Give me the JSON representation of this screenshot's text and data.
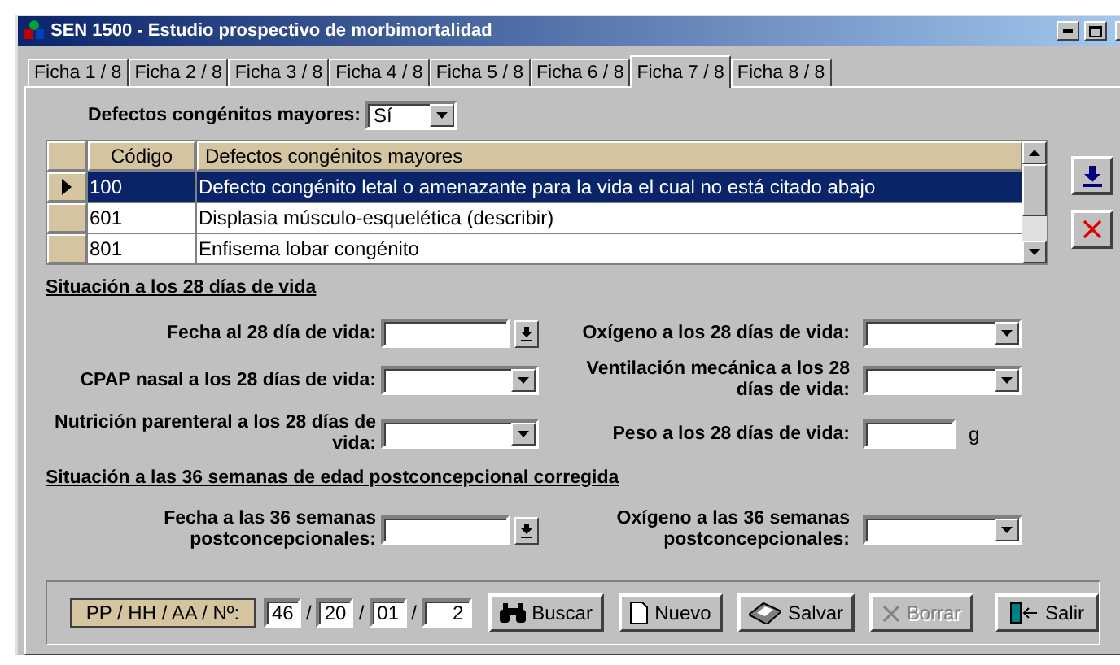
{
  "window": {
    "title": "SEN 1500 - Estudio prospectivo de morbimortalidad"
  },
  "tabs": [
    {
      "label": "Ficha 1 / 8",
      "selected": false
    },
    {
      "label": "Ficha 2 / 8",
      "selected": false
    },
    {
      "label": "Ficha 3 / 8",
      "selected": false
    },
    {
      "label": "Ficha 4 / 8",
      "selected": false
    },
    {
      "label": "Ficha 5 / 8",
      "selected": false
    },
    {
      "label": "Ficha 6 / 8",
      "selected": false
    },
    {
      "label": "Ficha 7 / 8",
      "selected": true
    },
    {
      "label": "Ficha 8 / 8",
      "selected": false
    }
  ],
  "defects_select": {
    "label": "Defectos congénitos mayores:",
    "value": "Sí"
  },
  "table": {
    "columns": [
      "Código",
      "Defectos congénitos mayores"
    ],
    "rows": [
      {
        "code": "100",
        "description": "Defecto congénito letal o amenazante para la vida el cual no está citado abajo",
        "selected": true
      },
      {
        "code": "601",
        "description": "Displasia músculo-esquelética (describir)",
        "selected": false
      },
      {
        "code": "801",
        "description": "Enfisema lobar congénito",
        "selected": false
      }
    ]
  },
  "sections": [
    {
      "heading": "Situación a los 28 días de vida",
      "fields": [
        {
          "label": "Fecha al 28 día de vida:",
          "kind": "date"
        },
        {
          "label": "Oxígeno a los 28 días de vida:",
          "kind": "combo"
        },
        {
          "label": "CPAP nasal a los 28 días de vida:",
          "kind": "combo"
        },
        {
          "label": "Ventilación mecánica a los 28 días de vida:",
          "kind": "combo"
        },
        {
          "label": "Nutrición parenteral a los 28 días de vida:",
          "kind": "combo"
        },
        {
          "label": "Peso a los 28 días de vida:",
          "kind": "number",
          "unit": "g"
        }
      ]
    },
    {
      "heading": "Situación a las 36 semanas de edad postconcepcional corregida",
      "fields": [
        {
          "label": "Fecha a las 36 semanas postconcepcionales:",
          "kind": "date"
        },
        {
          "label": "Oxígeno a las 36 semanas postconcepcionales:",
          "kind": "combo"
        }
      ]
    }
  ],
  "footer": {
    "record_label": "PP / HH / AA / Nº:",
    "record_parts": [
      {
        "value": "46",
        "separator": "/"
      },
      {
        "value": "20",
        "separator": "/"
      },
      {
        "value": "01",
        "separator": "/"
      },
      {
        "value": "2"
      }
    ],
    "buttons": [
      {
        "label": "Buscar",
        "kind": "search",
        "disabled": false
      },
      {
        "label": "Nuevo",
        "kind": "new",
        "disabled": false
      },
      {
        "label": "Salvar",
        "kind": "save",
        "disabled": false
      },
      {
        "label": "Borrar",
        "kind": "delete",
        "disabled": true
      },
      {
        "label": "Salir",
        "kind": "exit",
        "disabled": false
      }
    ]
  }
}
